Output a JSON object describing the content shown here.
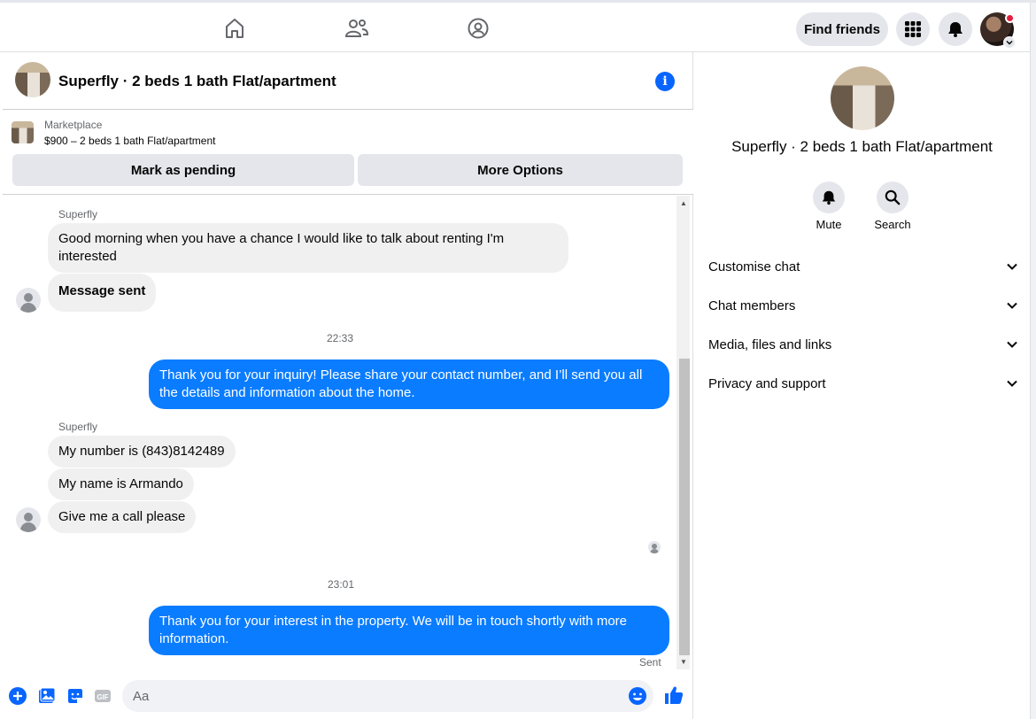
{
  "topbar": {
    "nav_icons": [
      "home-icon",
      "friends-icon",
      "groups-icon"
    ],
    "find_friends_label": "Find friends",
    "menu_icon": "grid-menu-icon",
    "notifications_icon": "bell-icon"
  },
  "chat": {
    "title": "Superfly · 2 beds 1 bath Flat/apartment",
    "marketplace": {
      "label": "Marketplace",
      "listing": "$900 – 2 beds 1 bath Flat/apartment",
      "mark_pending_label": "Mark as pending",
      "more_options_label": "More Options"
    },
    "messages": {
      "sender1": "Superfly",
      "msg1": "Good morning when you have a chance I would like to talk about renting I'm interested",
      "msg2": "Message sent",
      "time1": "22:33",
      "msg3": "Thank you for your inquiry! Please share your contact number, and I’ll send you all the details and information about the home.",
      "sender2": "Superfly",
      "msg4": "My number is (843)8142489",
      "msg5": "My name is Armando",
      "msg6": "Give me a call please",
      "time2": "23:01",
      "msg7": "Thank you for your interest in the property. We will be in touch shortly with more information.",
      "status": "Sent"
    },
    "composer": {
      "placeholder": "Aa"
    }
  },
  "right_panel": {
    "title": "Superfly · 2 beds 1 bath Flat/apartment",
    "mute_label": "Mute",
    "search_label": "Search",
    "sections": {
      "customise": "Customise chat",
      "members": "Chat members",
      "media": "Media, files and links",
      "privacy": "Privacy and support"
    }
  },
  "colors": {
    "accent": "#0866ff",
    "outgoing_bubble": "#0a7cff",
    "incoming_bubble": "#f0f0f0",
    "notification_dot": "#e41e3f"
  }
}
